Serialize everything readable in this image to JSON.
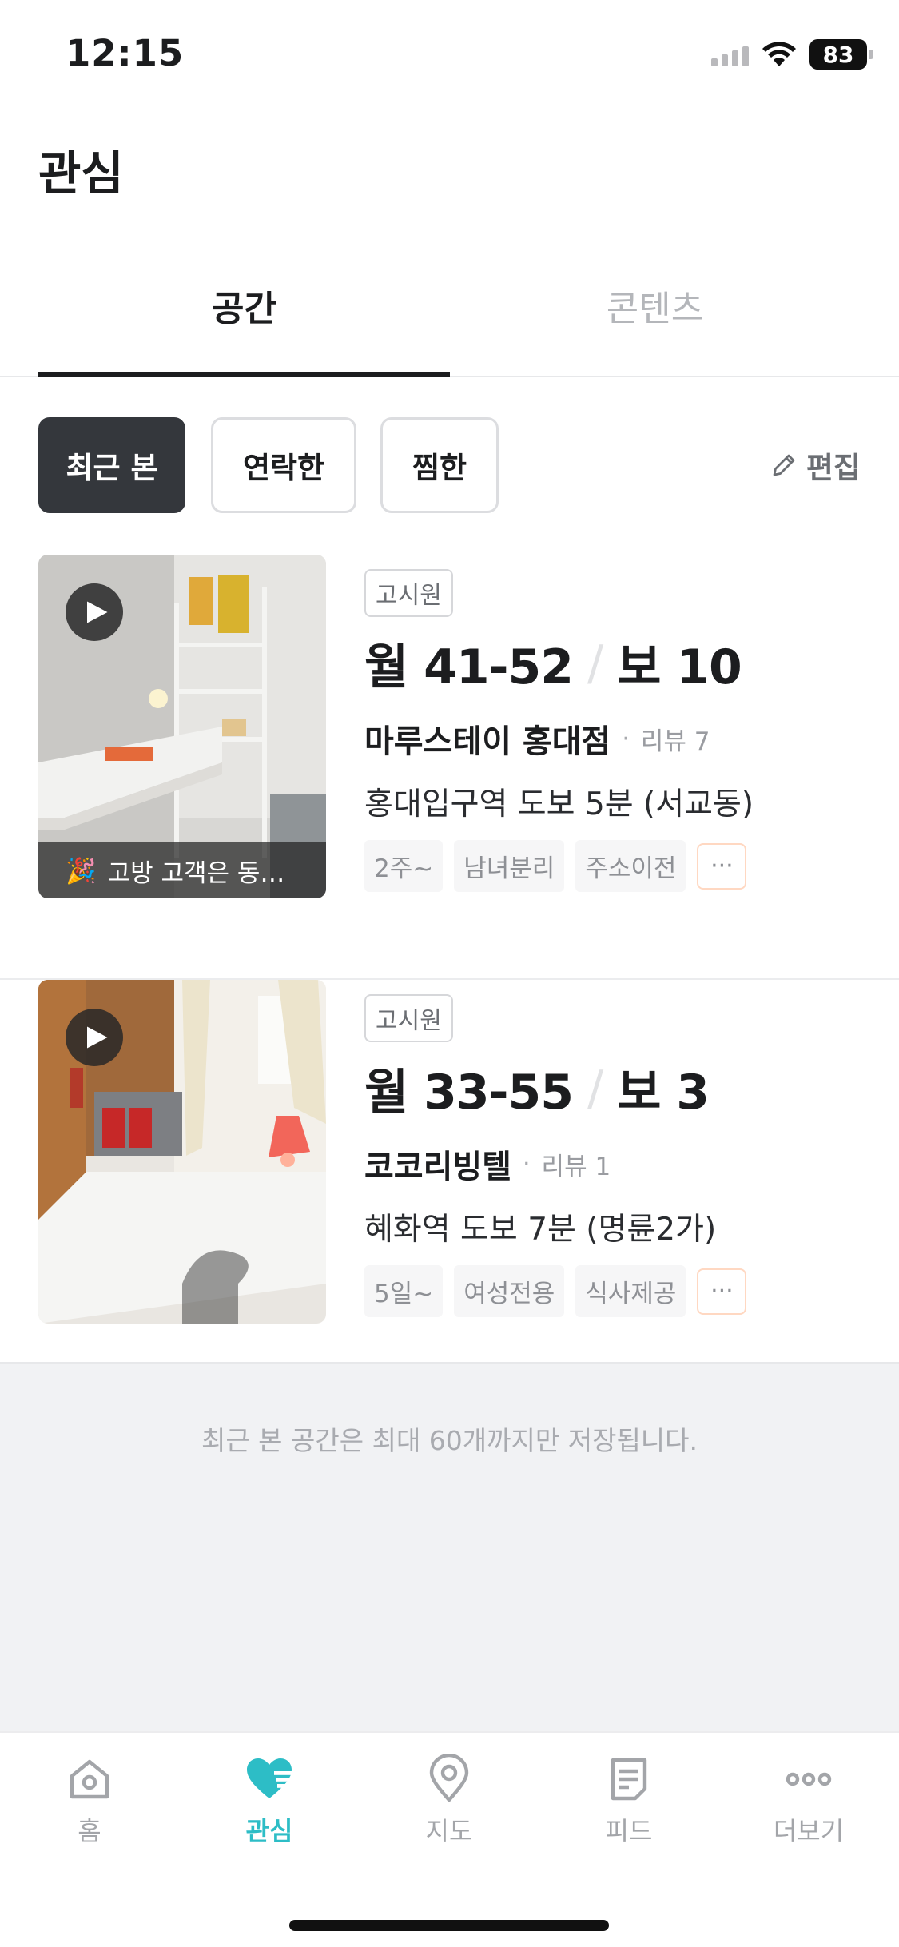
{
  "status_bar": {
    "time": "12:15",
    "battery": "83"
  },
  "header": {
    "title": "관심"
  },
  "tabs": [
    {
      "label": "공간",
      "active": true
    },
    {
      "label": "콘텐츠",
      "active": false
    }
  ],
  "filters": {
    "chips": [
      {
        "label": "최근 본",
        "active": true
      },
      {
        "label": "연락한",
        "active": false
      },
      {
        "label": "찜한",
        "active": false
      }
    ],
    "edit_label": "편집"
  },
  "listings": [
    {
      "caption": "고방 고객은 동…",
      "type": "고시원",
      "rent": "월 41-52",
      "deposit": "보 10",
      "name": "마루스테이 홍대점",
      "review": "리뷰 7",
      "location": "홍대입구역 도보 5분 (서교동)",
      "tags": [
        "2주~",
        "남녀분리",
        "주소이전"
      ],
      "more": "···"
    },
    {
      "caption": "",
      "type": "고시원",
      "rent": "월 33-55",
      "deposit": "보 3",
      "name": "코코리빙텔",
      "review": "리뷰 1",
      "location": "혜화역 도보 7분 (명륜2가)",
      "tags": [
        "5일~",
        "여성전용",
        "식사제공"
      ],
      "more": "···"
    }
  ],
  "notice": "최근 본 공간은 최대 60개까지만 저장됩니다.",
  "bottom_nav": [
    {
      "label": "홈",
      "icon": "home-icon"
    },
    {
      "label": "관심",
      "icon": "heart-icon",
      "active": true
    },
    {
      "label": "지도",
      "icon": "map-pin-icon"
    },
    {
      "label": "피드",
      "icon": "feed-icon"
    },
    {
      "label": "더보기",
      "icon": "more-icon"
    }
  ],
  "colors": {
    "accent": "#2dbdc6",
    "chip_active": "#34373c"
  }
}
